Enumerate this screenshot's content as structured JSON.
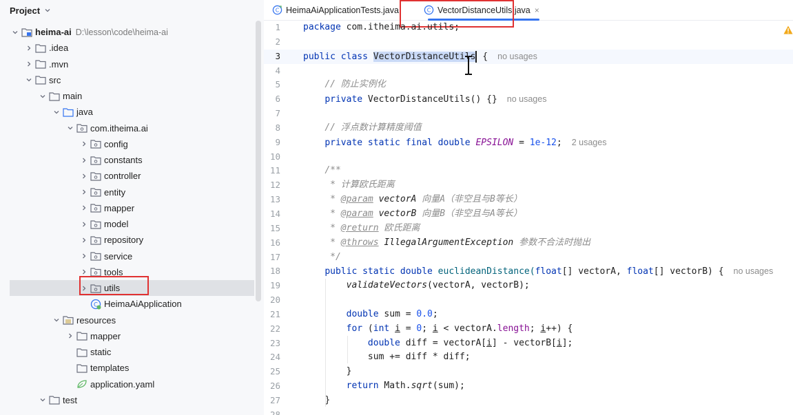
{
  "project": {
    "title": "Project",
    "tree": [
      {
        "label": "heima-ai",
        "path": "D:\\lesson\\code\\heima-ai",
        "depth": 0,
        "expanded": true,
        "icon": "module-folder-icon",
        "bold": true
      },
      {
        "label": ".idea",
        "depth": 1,
        "expanded": false,
        "icon": "folder-icon"
      },
      {
        "label": ".mvn",
        "depth": 1,
        "expanded": false,
        "icon": "folder-icon"
      },
      {
        "label": "src",
        "depth": 1,
        "expanded": true,
        "icon": "folder-icon"
      },
      {
        "label": "main",
        "depth": 2,
        "expanded": true,
        "icon": "folder-icon"
      },
      {
        "label": "java",
        "depth": 3,
        "expanded": true,
        "icon": "source-folder-icon"
      },
      {
        "label": "com.itheima.ai",
        "depth": 4,
        "expanded": true,
        "icon": "package-icon"
      },
      {
        "label": "config",
        "depth": 5,
        "expanded": false,
        "icon": "package-icon"
      },
      {
        "label": "constants",
        "depth": 5,
        "expanded": false,
        "icon": "package-icon"
      },
      {
        "label": "controller",
        "depth": 5,
        "expanded": false,
        "icon": "package-icon"
      },
      {
        "label": "entity",
        "depth": 5,
        "expanded": false,
        "icon": "package-icon"
      },
      {
        "label": "mapper",
        "depth": 5,
        "expanded": false,
        "icon": "package-icon"
      },
      {
        "label": "model",
        "depth": 5,
        "expanded": false,
        "icon": "package-icon"
      },
      {
        "label": "repository",
        "depth": 5,
        "expanded": false,
        "icon": "package-icon"
      },
      {
        "label": "service",
        "depth": 5,
        "expanded": false,
        "icon": "package-icon"
      },
      {
        "label": "tools",
        "depth": 5,
        "expanded": false,
        "icon": "package-icon"
      },
      {
        "label": "utils",
        "depth": 5,
        "expanded": false,
        "icon": "package-icon",
        "selected": true
      },
      {
        "label": "HeimaAiApplication",
        "depth": 5,
        "icon": "spring-class-icon"
      },
      {
        "label": "resources",
        "depth": 3,
        "expanded": true,
        "icon": "resources-folder-icon"
      },
      {
        "label": "mapper",
        "depth": 4,
        "expanded": false,
        "icon": "folder-icon"
      },
      {
        "label": "static",
        "depth": 4,
        "icon": "folder-icon"
      },
      {
        "label": "templates",
        "depth": 4,
        "icon": "folder-icon"
      },
      {
        "label": "application.yaml",
        "depth": 4,
        "icon": "yaml-icon"
      },
      {
        "label": "test",
        "depth": 2,
        "expanded": true,
        "icon": "folder-icon"
      }
    ]
  },
  "editor": {
    "tabs": [
      {
        "label": "HeimaAiApplicationTests.java",
        "active": false
      },
      {
        "label": "VectorDistanceUtils.java",
        "active": true,
        "close": "×"
      }
    ],
    "current_line": 3,
    "hints": {
      "no_usages": "no usages",
      "two_usages": "2 usages"
    },
    "lines": {
      "1": "1",
      "2": "2",
      "3": "3",
      "4": "4",
      "5": "5",
      "6": "6",
      "7": "7",
      "8": "8",
      "9": "9",
      "10": "10",
      "11": "11",
      "12": "12",
      "13": "13",
      "14": "14",
      "15": "15",
      "16": "16",
      "17": "17",
      "18": "18",
      "19": "19",
      "20": "20",
      "21": "21",
      "22": "22",
      "23": "23",
      "24": "24",
      "25": "25",
      "26": "26",
      "27": "27",
      "28": "28"
    },
    "code": {
      "l1_pkg": "package",
      "l1_name": " com.itheima.ai.utils;",
      "l3_public": "public",
      "l3_class": " class ",
      "l3_name": "VectorDistanceUtils",
      "l3_brace": " {",
      "l5_comment": "// 防止实例化",
      "l6_private": "private",
      "l6_ctor": " VectorDistanceUtils() {}",
      "l8_comment": "// 浮点数计算精度阈值",
      "l9_mods": "private static final double",
      "l9_const": "EPSILON",
      "l9_eq": " = ",
      "l9_val": "1e-12",
      "l9_semi": ";",
      "l11": "/**",
      "l12": " * 计算欧氏距离",
      "l13_tag": "@param",
      "l13_name": "vectorA",
      "l13_desc": " 向量A（非空且与B等长）",
      "l14_tag": "@param",
      "l14_name": "vectorB",
      "l14_desc": " 向量B（非空且与A等长）",
      "l15_tag": "@return",
      "l15_desc": " 欧氏距离",
      "l16_tag": "@throws",
      "l16_name": "IllegalArgumentException",
      "l16_desc": " 参数不合法时抛出",
      "l17": " */",
      "l18_mods": "public static double",
      "l18_name": " euclideanDistance(",
      "l18_t1": "float",
      "l18_p1": "[] vectorA, ",
      "l18_t2": "float",
      "l18_p2": "[] vectorB) {",
      "l19_call": "validateVectors",
      "l19_args": "(vectorA, vectorB);",
      "l21_type": "double",
      "l21_rest": " sum = ",
      "l21_val": "0.0",
      "l21_semi": ";",
      "l22_for": "for",
      "l22_a": " (",
      "l22_int": "int",
      "l22_i": "i",
      "l22_b": " = ",
      "l22_zero": "0",
      "l22_c": "; ",
      "l22_i2": "i",
      "l22_d": " < vectorA.",
      "l22_len": "length",
      "l22_e": "; ",
      "l22_i3": "i",
      "l22_f": "++) {",
      "l23_type": "double",
      "l23_a": " diff = vectorA[",
      "l23_i": "i",
      "l23_b": "] - vectorB[",
      "l23_i2": "i",
      "l23_c": "];",
      "l24": "sum += diff * diff;",
      "l25": "}",
      "l26_ret": "return",
      "l26_a": " Math.",
      "l26_sqrt": "sqrt",
      "l26_b": "(sum);",
      "l27": "}"
    }
  },
  "colors": {
    "keyword": "#0033b3",
    "comment": "#8c8c8c",
    "number": "#1750eb",
    "field": "#871094",
    "highlight_box": "#e03131",
    "selection": "#c9d9f6"
  }
}
